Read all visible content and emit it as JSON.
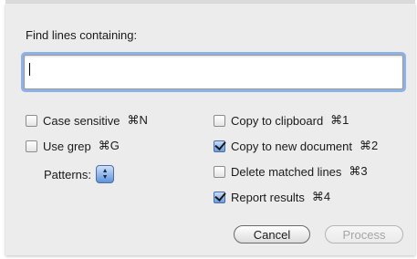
{
  "dialog": {
    "prompt_label": "Find lines containing:",
    "search_value": "",
    "left_options": [
      {
        "label": "Case sensitive",
        "shortcut": "⌘N",
        "checked": false
      },
      {
        "label": "Use grep",
        "shortcut": "⌘G",
        "checked": false
      }
    ],
    "patterns_label": "Patterns:",
    "right_options": [
      {
        "label": "Copy to clipboard",
        "shortcut": "⌘1",
        "checked": false
      },
      {
        "label": "Copy to new document",
        "shortcut": "⌘2",
        "checked": true
      },
      {
        "label": "Delete matched lines",
        "shortcut": "⌘3",
        "checked": false
      },
      {
        "label": "Report results",
        "shortcut": "⌘4",
        "checked": true
      }
    ],
    "cancel_label": "Cancel",
    "process_label": "Process"
  },
  "colors": {
    "accent": "#6c9ee0",
    "focus_ring": "#8fb2e6",
    "dialog_bg": "#ececec",
    "disabled_text": "#a5a5a5"
  }
}
